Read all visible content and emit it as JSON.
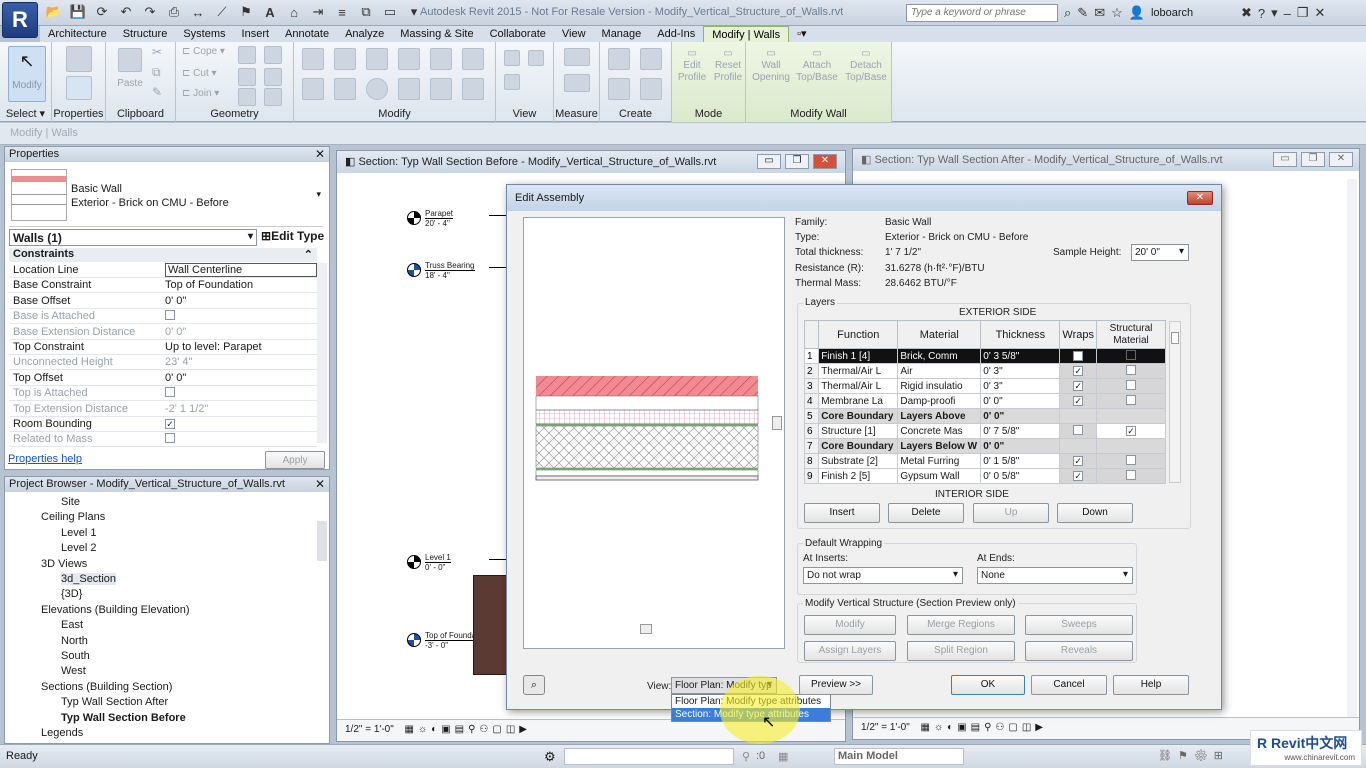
{
  "app": {
    "title": "Autodesk Revit 2015 - Not For Resale Version -   Modify_Vertical_Structure_of_Walls.rvt",
    "search_placeholder": "Type a keyword or phrase",
    "user": "loboarch",
    "logo": "R"
  },
  "tabs": [
    "Architecture",
    "Structure",
    "Systems",
    "Insert",
    "Annotate",
    "Analyze",
    "Massing & Site",
    "Collaborate",
    "View",
    "Manage",
    "Add-Ins",
    "Modify | Walls"
  ],
  "ribbon": {
    "panels": [
      "Select ▾",
      "Properties",
      "Clipboard",
      "Geometry",
      "Modify",
      "View",
      "Measure",
      "Create",
      "Mode",
      "Modify Wall"
    ],
    "modify": "Modify",
    "properties": "Properties",
    "paste": "Paste",
    "cope": "Cope",
    "cut": "Cut",
    "join": "Join",
    "edit_profile": "Edit Profile",
    "reset_profile": "Reset Profile",
    "wall_opening": "Wall Opening",
    "attach": "Attach Top/Base",
    "detach": "Detach Top/Base"
  },
  "context_line": "Modify | Walls",
  "properties": {
    "title": "Properties",
    "type_name": "Basic Wall",
    "type_sub": "Exterior - Brick on CMU - Before",
    "selector": "Walls (1)",
    "edit_type": "Edit Type",
    "section": "Constraints",
    "rows": [
      {
        "k": "Location Line",
        "v": "Wall Centerline",
        "dis": false
      },
      {
        "k": "Base Constraint",
        "v": "Top of Foundation",
        "dis": false
      },
      {
        "k": "Base Offset",
        "v": "0'  0\"",
        "dis": false
      },
      {
        "k": "Base is Attached",
        "v": "",
        "dis": true,
        "cb": ""
      },
      {
        "k": "Base Extension Distance",
        "v": "0'  0\"",
        "dis": true
      },
      {
        "k": "Top Constraint",
        "v": "Up to level: Parapet",
        "dis": false
      },
      {
        "k": "Unconnected Height",
        "v": "23'  4\"",
        "dis": true
      },
      {
        "k": "Top Offset",
        "v": "0'  0\"",
        "dis": false
      },
      {
        "k": "Top is Attached",
        "v": "",
        "dis": true,
        "cb": ""
      },
      {
        "k": "Top Extension Distance",
        "v": "-2'  1 1/2\"",
        "dis": true
      },
      {
        "k": "Room Bounding",
        "v": "",
        "dis": false,
        "cb": "✓"
      },
      {
        "k": "Related to Mass",
        "v": "",
        "dis": true,
        "cb": ""
      }
    ],
    "help": "Properties help",
    "apply": "Apply"
  },
  "browser": {
    "title": "Project Browser - Modify_Vertical_Structure_of_Walls.rvt",
    "items": [
      {
        "t": "Site",
        "x": 60,
        "bold": false
      },
      {
        "t": "Ceiling Plans",
        "x": 40,
        "bold": false
      },
      {
        "t": "Level 1",
        "x": 60,
        "bold": false
      },
      {
        "t": "Level 2",
        "x": 60,
        "bold": false
      },
      {
        "t": "3D Views",
        "x": 40,
        "bold": false
      },
      {
        "t": "3d_Section",
        "x": 60,
        "bold": false
      },
      {
        "t": "{3D}",
        "x": 60,
        "bold": false
      },
      {
        "t": "Elevations (Building Elevation)",
        "x": 40,
        "bold": false
      },
      {
        "t": "East",
        "x": 60,
        "bold": false
      },
      {
        "t": "North",
        "x": 60,
        "bold": false
      },
      {
        "t": "South",
        "x": 60,
        "bold": false
      },
      {
        "t": "West",
        "x": 60,
        "bold": false
      },
      {
        "t": "Sections (Building Section)",
        "x": 40,
        "bold": false
      },
      {
        "t": "Typ Wall Section After",
        "x": 60,
        "bold": false
      },
      {
        "t": "Typ Wall Section Before",
        "x": 60,
        "bold": true
      },
      {
        "t": "Legends",
        "x": 40,
        "bold": false
      }
    ]
  },
  "view_left": {
    "title": "Section: Typ Wall Section Before - Modify_Vertical_Structure_of_Walls.rvt",
    "scale": "1/2\" = 1'-0\"",
    "levels": [
      {
        "name": "Parapet",
        "elev": "20' - 4\""
      },
      {
        "name": "Truss Bearing",
        "elev": "18' - 4\""
      },
      {
        "name": "Level 1",
        "elev": "0' - 0\""
      },
      {
        "name": "Top of Foundation",
        "elev": "-3' - 0\""
      }
    ]
  },
  "view_right": {
    "title": "Section: Typ Wall Section After - Modify_Vertical_Structure_of_Walls.rvt",
    "scale": "1/2\" = 1'-0\""
  },
  "dialog": {
    "title": "Edit Assembly",
    "family_l": "Family:",
    "family": "Basic Wall",
    "type_l": "Type:",
    "type": "Exterior - Brick on CMU - Before",
    "thick_l": "Total thickness:",
    "thick": "1'  7 1/2\"",
    "sample_l": "Sample Height:",
    "sample": "20'  0\"",
    "res_l": "Resistance (R):",
    "res": "31.6278 (h·ft²·°F)/BTU",
    "mass_l": "Thermal Mass:",
    "mass": "28.6462 BTU/°F",
    "layers": "Layers",
    "ext": "EXTERIOR SIDE",
    "int": "INTERIOR SIDE",
    "cols": [
      "Function",
      "Material",
      "Thickness",
      "Wraps",
      "Structural Material"
    ],
    "rows": [
      {
        "n": "1",
        "f": "Finish 1 [4]",
        "m": "Brick, Comm",
        "t": "0'  3 5/8\"",
        "w": "✓",
        "s": "",
        "sel": true,
        "bold": false
      },
      {
        "n": "2",
        "f": "Thermal/Air L",
        "m": "Air",
        "t": "0'  3\"",
        "w": "✓",
        "s": "",
        "sel": false,
        "bold": false
      },
      {
        "n": "3",
        "f": "Thermal/Air L",
        "m": "Rigid insulatio",
        "t": "0'  3\"",
        "w": "✓",
        "s": "",
        "sel": false,
        "bold": false
      },
      {
        "n": "4",
        "f": "Membrane La",
        "m": "Damp-proofi",
        "t": "0'  0\"",
        "w": "✓",
        "s": "",
        "sel": false,
        "bold": false
      },
      {
        "n": "5",
        "f": "Core Boundary",
        "m": "Layers Above",
        "t": "0'  0\"",
        "w": "",
        "s": "",
        "sel": false,
        "bold": true
      },
      {
        "n": "6",
        "f": "Structure [1]",
        "m": "Concrete Mas",
        "t": "0'  7 5/8\"",
        "w": "",
        "s": "✓",
        "sel": false,
        "bold": false
      },
      {
        "n": "7",
        "f": "Core Boundary",
        "m": "Layers Below W",
        "t": "0'  0\"",
        "w": "",
        "s": "",
        "sel": false,
        "bold": true
      },
      {
        "n": "8",
        "f": "Substrate [2]",
        "m": "Metal Furring",
        "t": "0'  1 5/8\"",
        "w": "✓",
        "s": "",
        "sel": false,
        "bold": false
      },
      {
        "n": "9",
        "f": "Finish 2 [5]",
        "m": "Gypsum Wall",
        "t": "0'  0 5/8\"",
        "w": "✓",
        "s": "",
        "sel": false,
        "bold": false
      }
    ],
    "insert": "Insert",
    "delete": "Delete",
    "up": "Up",
    "down": "Down",
    "wrap_title": "Default Wrapping",
    "at_inserts": "At Inserts:",
    "at_inserts_v": "Do not wrap",
    "at_ends": "At Ends:",
    "at_ends_v": "None",
    "mvs_title": "Modify Vertical Structure (Section Preview only)",
    "mvs": [
      "Modify",
      "Merge Regions",
      "Sweeps",
      "Assign Layers",
      "Split Region",
      "Reveals"
    ],
    "view_l": "View:",
    "view_v": "Floor Plan: Modify typ",
    "view_opts": [
      "Floor Plan: Modify type attributes",
      "Section: Modify type attributes"
    ],
    "preview": "Preview >>",
    "ok": "OK",
    "cancel": "Cancel",
    "help": "Help"
  },
  "status": {
    "text": "Ready",
    "model": "Main Model",
    "zero": ":0",
    "watermark": "Revit中文网",
    "watermark_url": "www.chinarevit.com"
  },
  "colors": {
    "brick": "#f08a93",
    "ribbon_active": "#e6f1d7",
    "selection": "#111111",
    "highlight": "#3b7dd8"
  }
}
